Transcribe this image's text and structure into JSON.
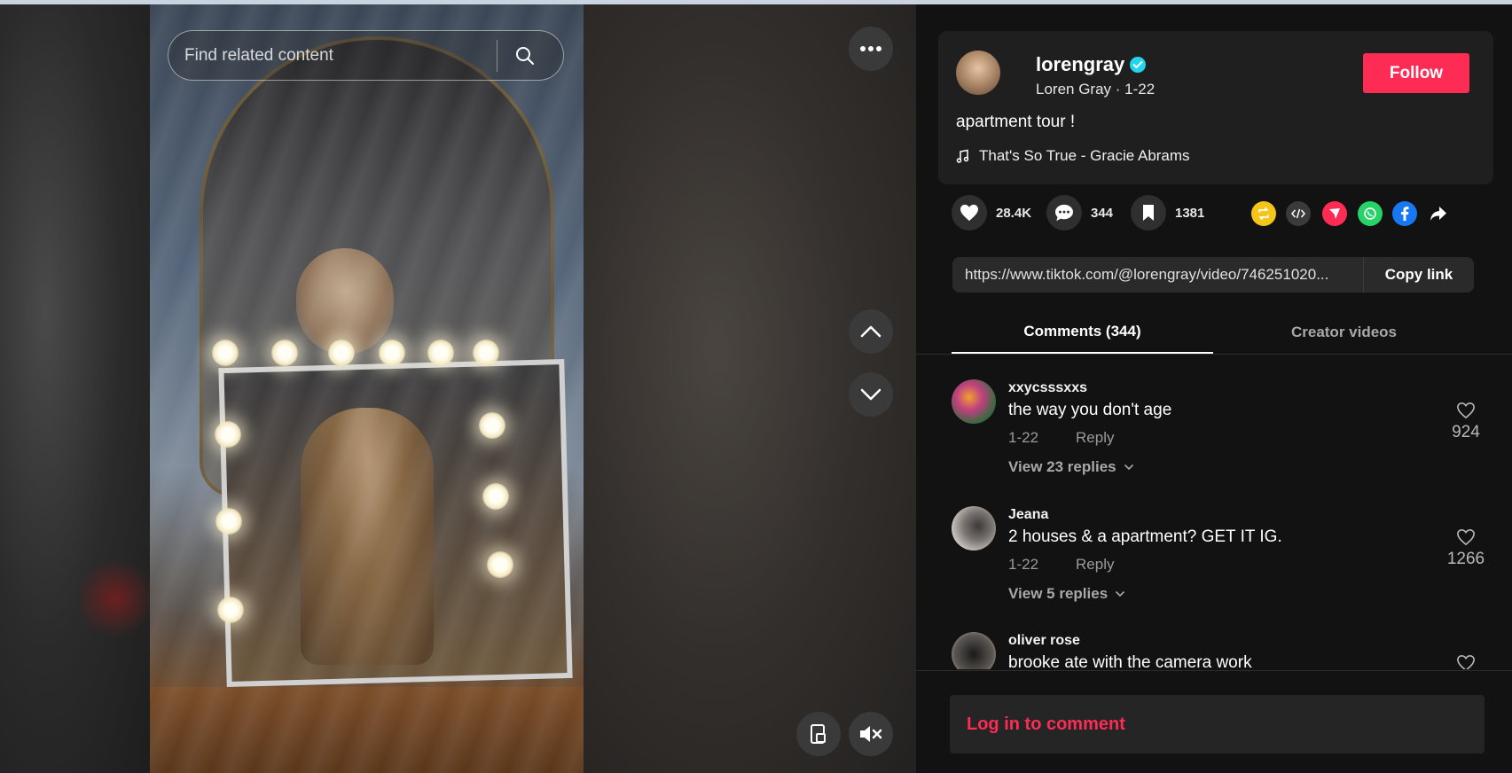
{
  "search": {
    "placeholder": "Find related content"
  },
  "author": {
    "username": "lorengray",
    "display_name": "Loren Gray",
    "date": "1-22",
    "follow_label": "Follow"
  },
  "post": {
    "description": "apartment tour !",
    "music": "That's So True - Gracie Abrams"
  },
  "stats": {
    "likes": "28.4K",
    "comments": "344",
    "saves": "1381"
  },
  "link": {
    "url": "https://www.tiktok.com/@lorengray/video/746251020...",
    "copy_label": "Copy link"
  },
  "tabs": [
    {
      "label": "Comments (344)",
      "active": true
    },
    {
      "label": "Creator videos",
      "active": false
    }
  ],
  "comments": [
    {
      "user": "xxycsssxxs",
      "text": "the way you don't age",
      "date": "1-22",
      "reply_label": "Reply",
      "view_replies": "View 23 replies",
      "likes": "924"
    },
    {
      "user": "Jeana",
      "text": "2 houses & a apartment? GET IT IG.",
      "date": "1-22",
      "reply_label": "Reply",
      "view_replies": "View 5 replies",
      "likes": "1266"
    },
    {
      "user": "oliver rose",
      "text": "brooke ate with the camera work",
      "date": "",
      "reply_label": "",
      "view_replies": "",
      "likes": ""
    }
  ],
  "comment_bar": {
    "login_label": "Log in to comment"
  },
  "colors": {
    "accent": "#fe2c55",
    "verified": "#20d5ec",
    "panel_bg": "#121212",
    "card_bg": "#1f1f1f"
  },
  "icons": [
    "search-icon",
    "more-icon",
    "chevron-up-icon",
    "chevron-down-icon",
    "pip-icon",
    "mute-icon",
    "verified-icon",
    "music-note-icon",
    "heart-icon",
    "comment-icon",
    "bookmark-icon",
    "repost-icon",
    "embed-icon",
    "send-icon",
    "whatsapp-icon",
    "facebook-icon",
    "share-arrow-icon"
  ]
}
